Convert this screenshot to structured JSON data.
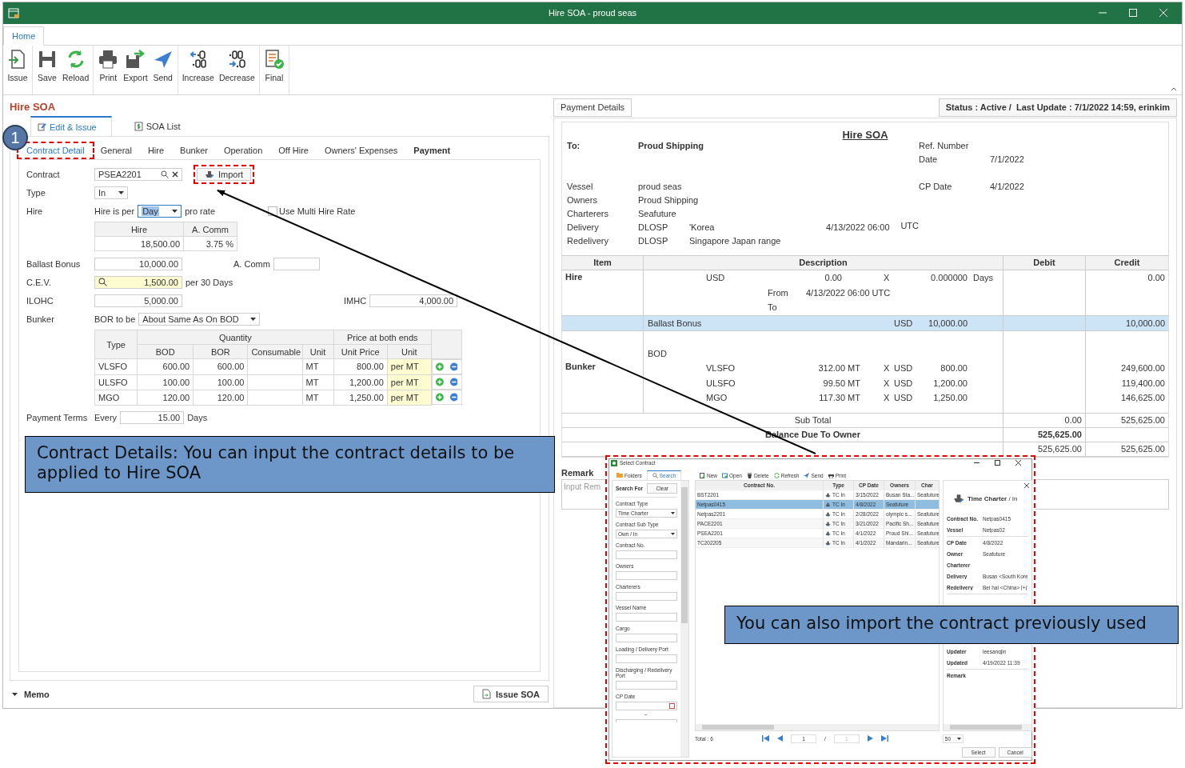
{
  "window": {
    "title": "Hire SOA - proud seas"
  },
  "ribbon": {
    "tabs": [
      {
        "label": "Home",
        "selected": true
      }
    ],
    "groups": [
      {
        "buttons": [
          "Issue"
        ]
      },
      {
        "buttons": [
          "Save",
          "Reload"
        ]
      },
      {
        "buttons": [
          "Print",
          "Export",
          "Send"
        ]
      },
      {
        "buttons": [
          "Increase",
          "Decrease"
        ]
      },
      {
        "buttons": [
          "Final"
        ]
      }
    ]
  },
  "left_panel": {
    "title": "Hire SOA",
    "tabs": [
      {
        "label": "Edit & Issue",
        "selected": true
      },
      {
        "label": "SOA List",
        "selected": false
      }
    ],
    "subtabs": [
      {
        "label": "Contract Detail",
        "selected": true,
        "highlighted": true,
        "emphasized": false
      },
      {
        "label": "General",
        "selected": false,
        "highlighted": false,
        "emphasized": false
      },
      {
        "label": "Hire",
        "selected": false,
        "highlighted": false,
        "emphasized": false
      },
      {
        "label": "Bunker",
        "selected": false,
        "highlighted": false,
        "emphasized": false
      },
      {
        "label": "Operation",
        "selected": false,
        "highlighted": false,
        "emphasized": false
      },
      {
        "label": "Off Hire",
        "selected": false,
        "highlighted": false,
        "emphasized": false
      },
      {
        "label": "Owners' Expenses",
        "selected": false,
        "highlighted": false,
        "emphasized": false
      },
      {
        "label": "Payment",
        "selected": false,
        "highlighted": false,
        "emphasized": true
      }
    ],
    "contract": {
      "label": "Contract",
      "value": "PSEA2201",
      "import_button": {
        "label": "Import",
        "highlighted": true
      }
    },
    "type": {
      "label": "Type",
      "value": "In"
    },
    "hire": {
      "label": "Hire",
      "prefix": "Hire is per",
      "unit": "Day",
      "suffix": "pro rate",
      "multi_rate": {
        "label": "Use Multi Hire Rate",
        "checked": false
      },
      "columns": [
        "Hire",
        "A. Comm"
      ],
      "values": [
        "18,500.00",
        "3.75 %"
      ]
    },
    "ballast_bonus": {
      "label": "Ballast Bonus",
      "value": "10,000.00",
      "comm_label": "A. Comm"
    },
    "cev": {
      "label": "C.E.V.",
      "value": "1,500.00",
      "suffix": "per 30 Days"
    },
    "ilohc": {
      "label": "ILOHC",
      "value": "5,000.00"
    },
    "imhc": {
      "label": "IMHC",
      "value": "4,000.00"
    },
    "bunker": {
      "label": "Bunker",
      "prefix": "BOR to be",
      "value": "About Same As On BOD",
      "headers": {
        "type": "Type",
        "quantity": "Quantity",
        "price": "Price at both ends",
        "columns": [
          "BOD",
          "BOR",
          "Consumable",
          "Unit",
          "Unit Price",
          "Unit"
        ]
      },
      "rows": [
        {
          "type": "VLSFO",
          "bod": "600.00",
          "bor": "600.00",
          "unit": "MT",
          "price": "800.00",
          "price_unit": "per MT"
        },
        {
          "type": "ULSFO",
          "bod": "100.00",
          "bor": "100.00",
          "unit": "MT",
          "price": "1,200.00",
          "price_unit": "per MT"
        },
        {
          "type": "MGO",
          "bod": "120.00",
          "bor": "120.00",
          "unit": "MT",
          "price": "1,250.00",
          "price_unit": "per MT"
        }
      ]
    },
    "payment_terms": {
      "label": "Payment Terms",
      "prefix": "Every",
      "value": "15.00",
      "suffix": "Days"
    },
    "memo": {
      "label": "Memo"
    },
    "issue_button": "Issue SOA"
  },
  "right_panel": {
    "payment_details": "Payment Details",
    "status": "Status : Active /  Last Update : 7/1/2022 14:59, erinkim",
    "soa": {
      "title": "Hire SOA",
      "to_label": "To:",
      "to": "Proud Shipping",
      "ref_label": "Ref. Number",
      "date_label": "Date",
      "date": "7/1/2022",
      "cp_date_label": "CP Date",
      "cp_date": "4/1/2022",
      "details": [
        {
          "label": "Vessel",
          "value": "proud seas"
        },
        {
          "label": "Owners",
          "value": "Proud Shipping"
        },
        {
          "label": "Charterers",
          "value": "Seafuture"
        },
        {
          "label": "Delivery",
          "value": "DLOSP",
          "place": "'Korea",
          "time": "4/13/2022 06:00",
          "zone": "UTC"
        },
        {
          "label": "Redelivery",
          "value": "DLOSP",
          "place": "Singapore Japan range"
        }
      ],
      "columns": [
        "Item",
        "Description",
        "Debit",
        "Credit"
      ],
      "rows": [
        {
          "kind": "hire",
          "selected": false,
          "item": "Hire",
          "currency": "USD",
          "rate": "0.00",
          "times": "X",
          "days": "0.000000",
          "unit": "Days",
          "credit": "0.00",
          "from_label": "From",
          "from": "4/13/2022 06:00 UTC",
          "to_label": "To"
        },
        {
          "kind": "line",
          "selected": true,
          "description": "Ballast Bonus",
          "currency": "USD",
          "amount": "10,000.00",
          "credit": "10,000.00"
        },
        {
          "kind": "bunker",
          "selected": false,
          "item": "Bunker",
          "label": "BOD",
          "lines": [
            {
              "fuel": "VLSFO",
              "qty": "312.00 MT",
              "times": "X",
              "currency": "USD",
              "price": "800.00",
              "credit": "249,600.00"
            },
            {
              "fuel": "ULSFO",
              "qty": "99.50 MT",
              "times": "X",
              "currency": "USD",
              "price": "1,200.00",
              "credit": "119,400.00"
            },
            {
              "fuel": "MGO",
              "qty": "117.30 MT",
              "times": "X",
              "currency": "USD",
              "price": "1,250.00",
              "credit": "146,625.00"
            }
          ]
        }
      ],
      "sub_total": {
        "label": "Sub Total",
        "debit": "0.00",
        "credit": "525,625.00"
      },
      "balance": {
        "label": "Balance Due To Owner",
        "debit": "525,625.00"
      },
      "total": {
        "debit": "525,625.00",
        "credit": "525,625.00"
      }
    },
    "remark": {
      "label": "Remark",
      "placeholder": "Input Rem"
    }
  },
  "dialog": {
    "title": "Select Contract",
    "highlighted": true,
    "side_tabs": [
      {
        "label": "Folders",
        "selected": false
      },
      {
        "label": "Search",
        "selected": true
      }
    ],
    "search_for": "Search For",
    "clear": "Clear",
    "filters": [
      {
        "label": "Contract Type",
        "kind": "dropdown",
        "value": "Time Charter"
      },
      {
        "label": "Contract Sub Type",
        "kind": "dropdown",
        "value": "Own / In"
      },
      {
        "label": "Contract No.",
        "kind": "text"
      },
      {
        "label": "Owners",
        "kind": "text"
      },
      {
        "label": "Charterers",
        "kind": "text"
      },
      {
        "label": "Vessel Name",
        "kind": "text"
      },
      {
        "label": "Cargo",
        "kind": "text"
      },
      {
        "label": "Loading / Delivery Port",
        "kind": "text"
      },
      {
        "label": "Discharging / Redelivery Port",
        "kind": "text"
      },
      {
        "label": "CP Date",
        "kind": "date_range",
        "separator": "~"
      }
    ],
    "toolbar": [
      "New",
      "Open",
      "Delete",
      "Refresh",
      "Send",
      "Print"
    ],
    "columns": [
      "Contract No.",
      "Type",
      "CP Date",
      "Owners",
      "Char"
    ],
    "rows": [
      {
        "contract": "BST2201",
        "type": "TC In",
        "cp_date": "3/15/2022",
        "owners": "Busan Sta...",
        "charterer": "Seafuture",
        "selected": false
      },
      {
        "contract": "Netpas0415",
        "type": "TC In",
        "cp_date": "4/8/2022",
        "owners": "Seafuture",
        "selected": true
      },
      {
        "contract": "Netpas2201",
        "type": "TC In",
        "cp_date": "2/28/2022",
        "owners": "olympic s...",
        "charterer": "Seafuture",
        "selected": false
      },
      {
        "contract": "PACE2201",
        "type": "TC In",
        "cp_date": "3/21/2022",
        "owners": "Pacific Sh...",
        "charterer": "Seafuture",
        "selected": false
      },
      {
        "contract": "PSEA2201",
        "type": "TC In",
        "cp_date": "4/1/2022",
        "owners": "Proud Shi...",
        "charterer": "Seafuture",
        "selected": false
      },
      {
        "contract": "TC202205",
        "type": "TC In",
        "cp_date": "4/1/2022",
        "owners": "Mandarin...",
        "charterer": "Seafuture",
        "selected": false
      }
    ],
    "detail": {
      "heading": "**Time Charter** / In",
      "sections": [
        [
          {
            "label": "Contract No.",
            "value": "Netpas0415"
          },
          {
            "label": "Vessel",
            "value": "Netpas02"
          }
        ],
        [
          {
            "label": "CP Date",
            "value": "4/8/2022"
          },
          {
            "label": "Owner",
            "value": "Seafuture"
          },
          {
            "label": "Charterer"
          },
          {
            "label": "Delivery",
            "value": "Busan <South Kore"
          },
          {
            "label": "Redelivery",
            "value": "Bei hai <China> [+("
          }
        ],
        [
          {
            "label": "Updater",
            "value": "leesangjin"
          },
          {
            "label": "Updated",
            "value": "4/19/2022 11:39"
          }
        ],
        [
          {
            "label": "Remark"
          }
        ]
      ]
    },
    "footer": {
      "total": "Total : 6",
      "page": "1",
      "separator": "/",
      "pages": "1",
      "page_size": "50",
      "select": "Select",
      "cancel": "Cancel"
    }
  },
  "callout": {
    "number": "1"
  },
  "notes": [
    "Contract Details: You can input the contract details to be applied to Hire SOA",
    "You can also import the contract previously used"
  ]
}
